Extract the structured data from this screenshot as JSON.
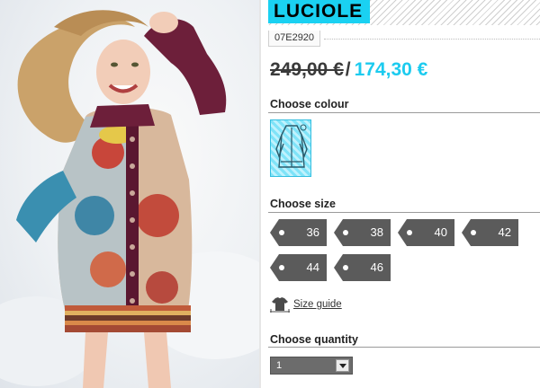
{
  "product": {
    "name": "LUCIOLE",
    "sku": "07E2920",
    "price_old": "249,00 €",
    "price_separator": "/",
    "price_new": "174,30 €"
  },
  "colour_section": {
    "label": "Choose colour",
    "selected_swatch_icon": "coat-thumbnail-icon"
  },
  "size_section": {
    "label": "Choose size",
    "sizes": [
      "36",
      "38",
      "40",
      "42",
      "44",
      "46"
    ]
  },
  "size_guide": {
    "label": "Size guide",
    "icon": "shirt-measure-icon"
  },
  "quantity_section": {
    "label": "Choose quantity",
    "value": "1"
  },
  "colors": {
    "accent": "#1ad1f2",
    "price_new": "#1ccbef",
    "size_tag": "#5b5b5b"
  }
}
